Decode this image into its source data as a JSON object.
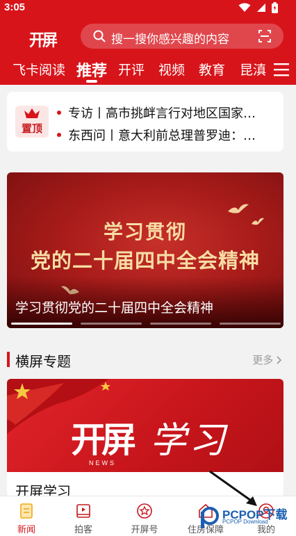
{
  "status_bar": {
    "time": "3:05"
  },
  "header": {
    "logo": "开屏",
    "search_placeholder": "搜一搜你感兴趣的内容"
  },
  "tabs": [
    {
      "label": "飞卡阅读",
      "active": false
    },
    {
      "label": "推荐",
      "active": true
    },
    {
      "label": "开评",
      "active": false
    },
    {
      "label": "视频",
      "active": false
    },
    {
      "label": "教育",
      "active": false
    },
    {
      "label": "昆滇",
      "active": false
    }
  ],
  "pinned": {
    "badge": "置顶",
    "items": [
      "专访丨高市挑衅言行对地区国家…",
      "东西问丨意大利前总理普罗迪：…"
    ]
  },
  "carousel": {
    "line1": "学习贯彻",
    "line2": "党的二十届四中全会精神",
    "caption": "学习贯彻党的二十届四中全会精神",
    "active_index": 0,
    "count": 4
  },
  "section": {
    "title": "横屏专题",
    "more": "更多"
  },
  "feature": {
    "logo": "开屏",
    "news": "NEWS",
    "study": "学习",
    "title": "开屏学习"
  },
  "bottom_nav": [
    {
      "label": "新闻",
      "icon": "news-icon",
      "active": true
    },
    {
      "label": "拍客",
      "icon": "video-icon",
      "active": false
    },
    {
      "label": "开屏号",
      "icon": "star-badge-icon",
      "active": false
    },
    {
      "label": "住房保障",
      "icon": "house-icon",
      "active": false
    },
    {
      "label": "我的",
      "icon": "profile-icon",
      "active": false
    }
  ],
  "watermark": {
    "text": "PCPOP下载",
    "sub": "PCPOP Download"
  },
  "colors": {
    "brand_red": "#d8141b",
    "gold_text": "#f7dca3"
  }
}
